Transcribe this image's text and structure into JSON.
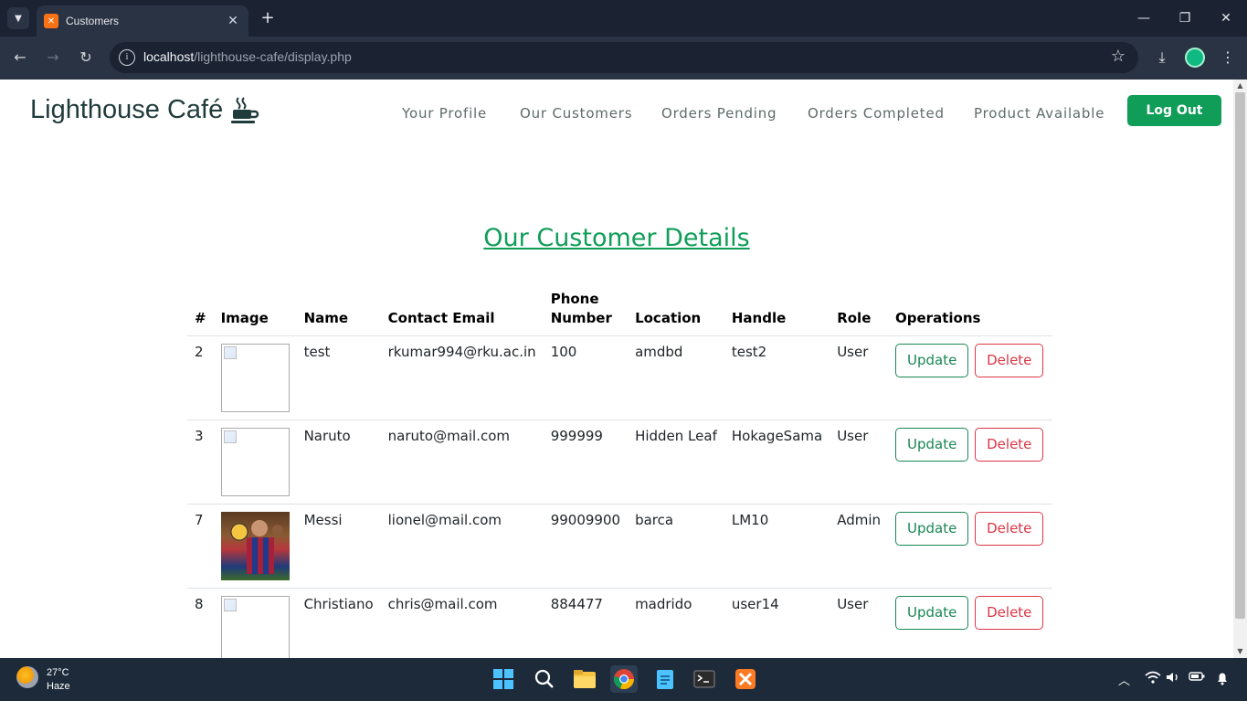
{
  "browser": {
    "tab_title": "Customers",
    "url_host": "localhost",
    "url_path": "/lighthouse-cafe/display.php"
  },
  "site": {
    "brand": "Lighthouse Café",
    "nav": [
      "Your Profile",
      "Our Customers",
      "Orders Pending",
      "Orders Completed",
      "Product Available"
    ],
    "logout_label": "Log Out"
  },
  "page": {
    "title": "Our Customer Details",
    "columns": [
      "#",
      "Image",
      "Name",
      "Contact Email",
      "Phone Number",
      "Location",
      "Handle",
      "Role",
      "Operations"
    ],
    "update_label": "Update",
    "delete_label": "Delete",
    "rows": [
      {
        "id": "2",
        "name": "test",
        "email": "rkumar994@rku.ac.in",
        "phone": "100",
        "location": "amdbd",
        "handle": "test2",
        "role": "User",
        "image": "broken"
      },
      {
        "id": "3",
        "name": "Naruto",
        "email": "naruto@mail.com",
        "phone": "999999",
        "location": "Hidden Leaf",
        "handle": "HokageSama",
        "role": "User",
        "image": "broken"
      },
      {
        "id": "7",
        "name": "Messi",
        "email": "lionel@mail.com",
        "phone": "99009900",
        "location": "barca",
        "handle": "LM10",
        "role": "Admin",
        "image": "photo"
      },
      {
        "id": "8",
        "name": "Christiano",
        "email": "chris@mail.com",
        "phone": "884477",
        "location": "madrido",
        "handle": "user14",
        "role": "User",
        "image": "broken"
      }
    ]
  },
  "taskbar": {
    "temperature": "27°C",
    "condition": "Haze"
  },
  "colors": {
    "accent": "#0f9d58",
    "update": "#198754",
    "delete": "#dc3545"
  }
}
